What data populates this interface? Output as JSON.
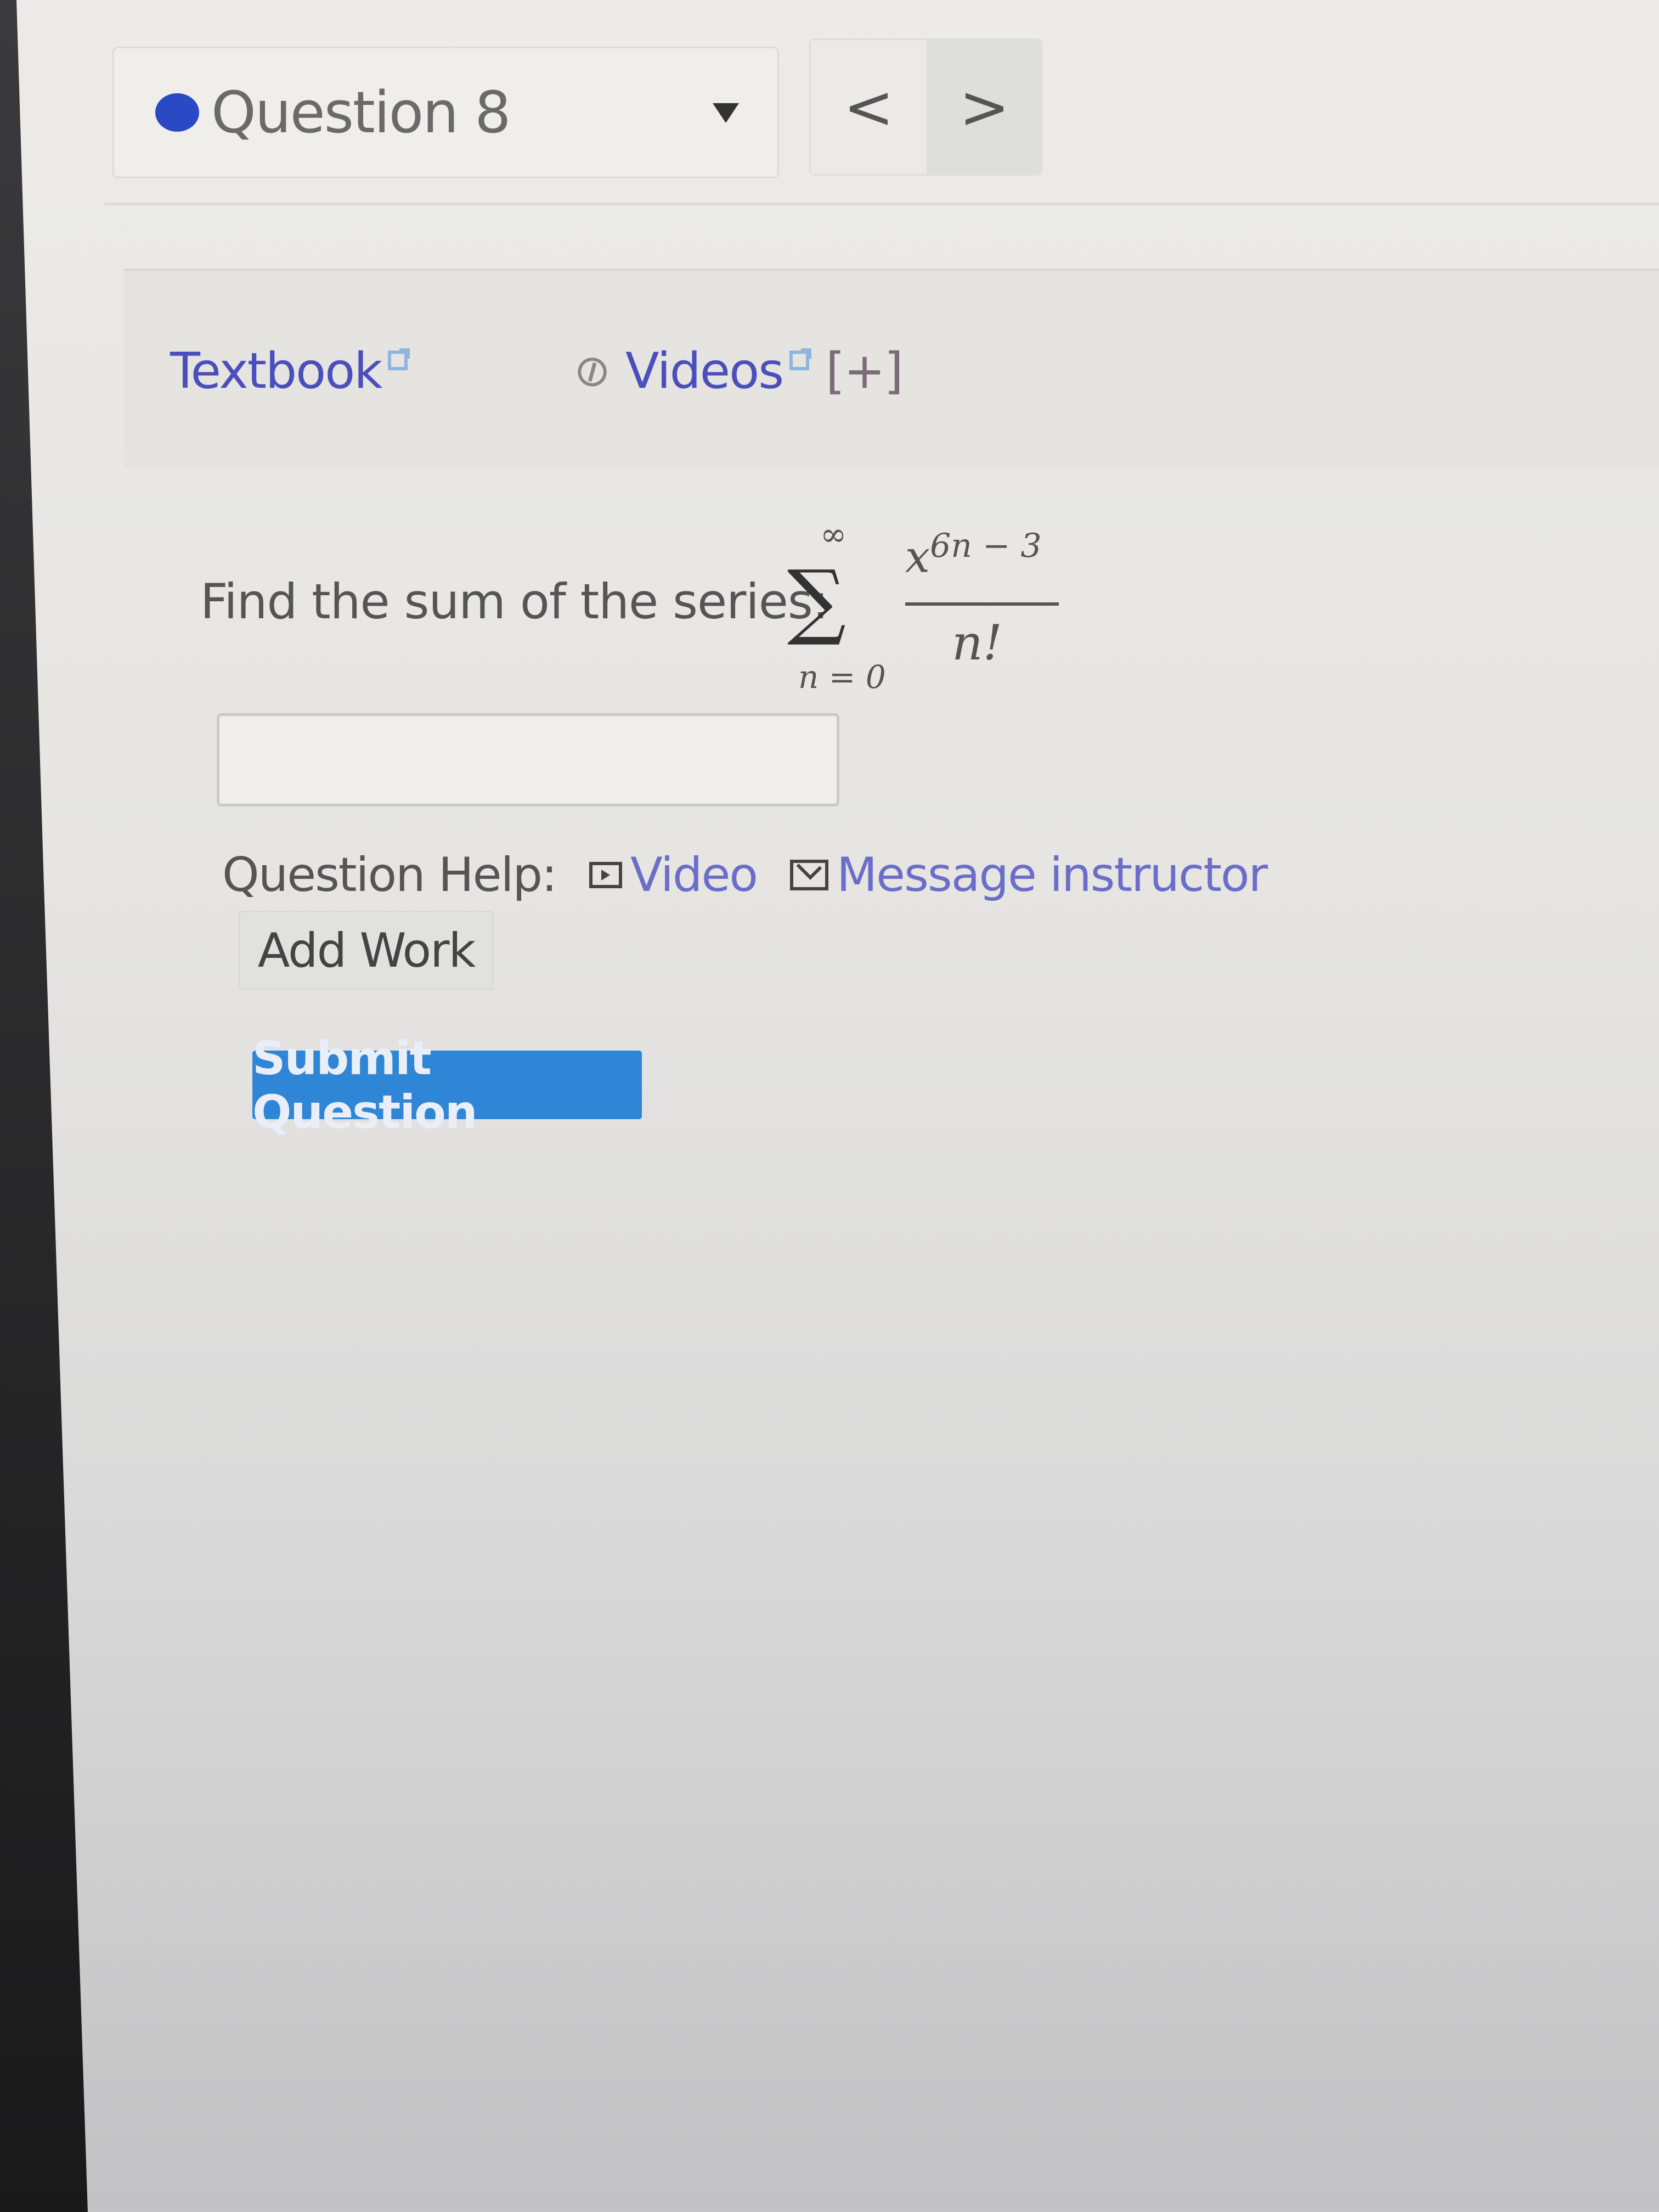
{
  "nav": {
    "question_label": "Question 8",
    "question_status_color": "#2a49c5",
    "prev_label": "<",
    "next_label": ">"
  },
  "resources": {
    "textbook_label": "Textbook",
    "videos_label": "Videos",
    "expand_label": "[+]"
  },
  "question": {
    "prompt": "Find the sum of the series:",
    "math": {
      "sum_upper": "∞",
      "sum_lower": "n = 0",
      "numerator_base": "x",
      "numerator_exponent": "6n − 3",
      "denominator": "n!"
    },
    "answer_value": ""
  },
  "help": {
    "label": "Question Help:",
    "video_label": "Video",
    "message_label": "Message instructor"
  },
  "buttons": {
    "add_work": "Add Work",
    "submit": "Submit Question"
  },
  "colors": {
    "link": "#4a4fbb",
    "submit_bg": "#2f86d6"
  }
}
